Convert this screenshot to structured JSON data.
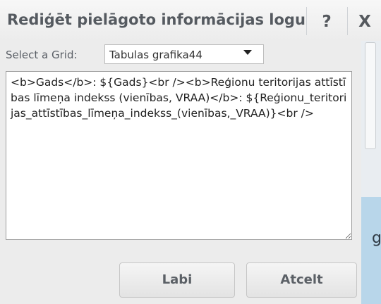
{
  "dialog": {
    "title": "Rediģēt pielāgoto informācijas logu",
    "help_label": "?",
    "close_label": "X"
  },
  "grid_select": {
    "label": "Select a Grid:",
    "value": "Tabulas grafika44"
  },
  "template": {
    "text": "<b>Gads</b>: ${Gads}<br /><b>Reģionu teritorijas attīstības līmeņa indekss (vienības, VRAA)</b>: ${Reģionu_teritorijas_attīstības_līmeņa_indekss_(vienības,_VRAA)}<br />"
  },
  "buttons": {
    "ok_label": "Labi",
    "cancel_label": "Atcelt"
  },
  "background": {
    "map_partial_label": "g"
  }
}
